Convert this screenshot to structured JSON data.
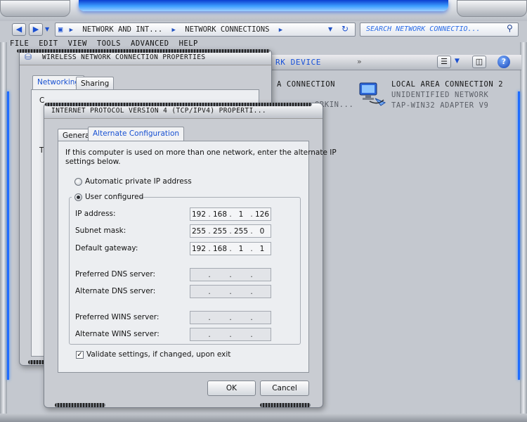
{
  "explorer": {
    "address": [
      "NETWORK AND INT...",
      "NETWORK CONNECTIONS"
    ],
    "search_placeholder": "SEARCH NETWORK CONNECTIO...",
    "menu": [
      "FILE",
      "EDIT",
      "VIEW",
      "TOOLS",
      "ADVANCED",
      "HELP"
    ],
    "toolbar_partial": "RK DEVICE",
    "chevron": "»"
  },
  "connections": {
    "left_partial_1": "A CONNECTION",
    "left_partial_2": "ORKIN...",
    "item": {
      "name": "LOCAL AREA CONNECTION 2",
      "status": "UNIDENTIFIED NETWORK",
      "adapter": "TAP-WIN32 ADAPTER V9"
    }
  },
  "wireless_dialog": {
    "title": "WIRELESS NETWORK CONNECTION PROPERTIES",
    "tabs": [
      "Networking",
      "Sharing"
    ],
    "partial_c": "C",
    "partial_t": "T"
  },
  "ipv4_dialog": {
    "title": "INTERNET PROTOCOL VERSION 4 (TCP/IPV4) PROPERTI...",
    "tabs": [
      "General",
      "Alternate Configuration"
    ],
    "intro": [
      "If this computer is used on more than one network, enter the alternate IP",
      "settings below."
    ],
    "radio_auto": "Automatic private IP address",
    "radio_user": "User configured",
    "fields": {
      "ip_label": "IP address:",
      "ip": [
        "192",
        "168",
        "1",
        "126"
      ],
      "mask_label": "Subnet mask:",
      "mask": [
        "255",
        "255",
        "255",
        "0"
      ],
      "gw_label": "Default gateway:",
      "gw": [
        "192",
        "168",
        "1",
        "1"
      ],
      "pdns_label": "Preferred DNS server:",
      "adns_label": "Alternate DNS server:",
      "pwins_label": "Preferred WINS server:",
      "awins_label": "Alternate WINS server:",
      "dot": "."
    },
    "validate": "Validate settings, if changed, upon exit",
    "ok": "OK",
    "cancel": "Cancel"
  }
}
